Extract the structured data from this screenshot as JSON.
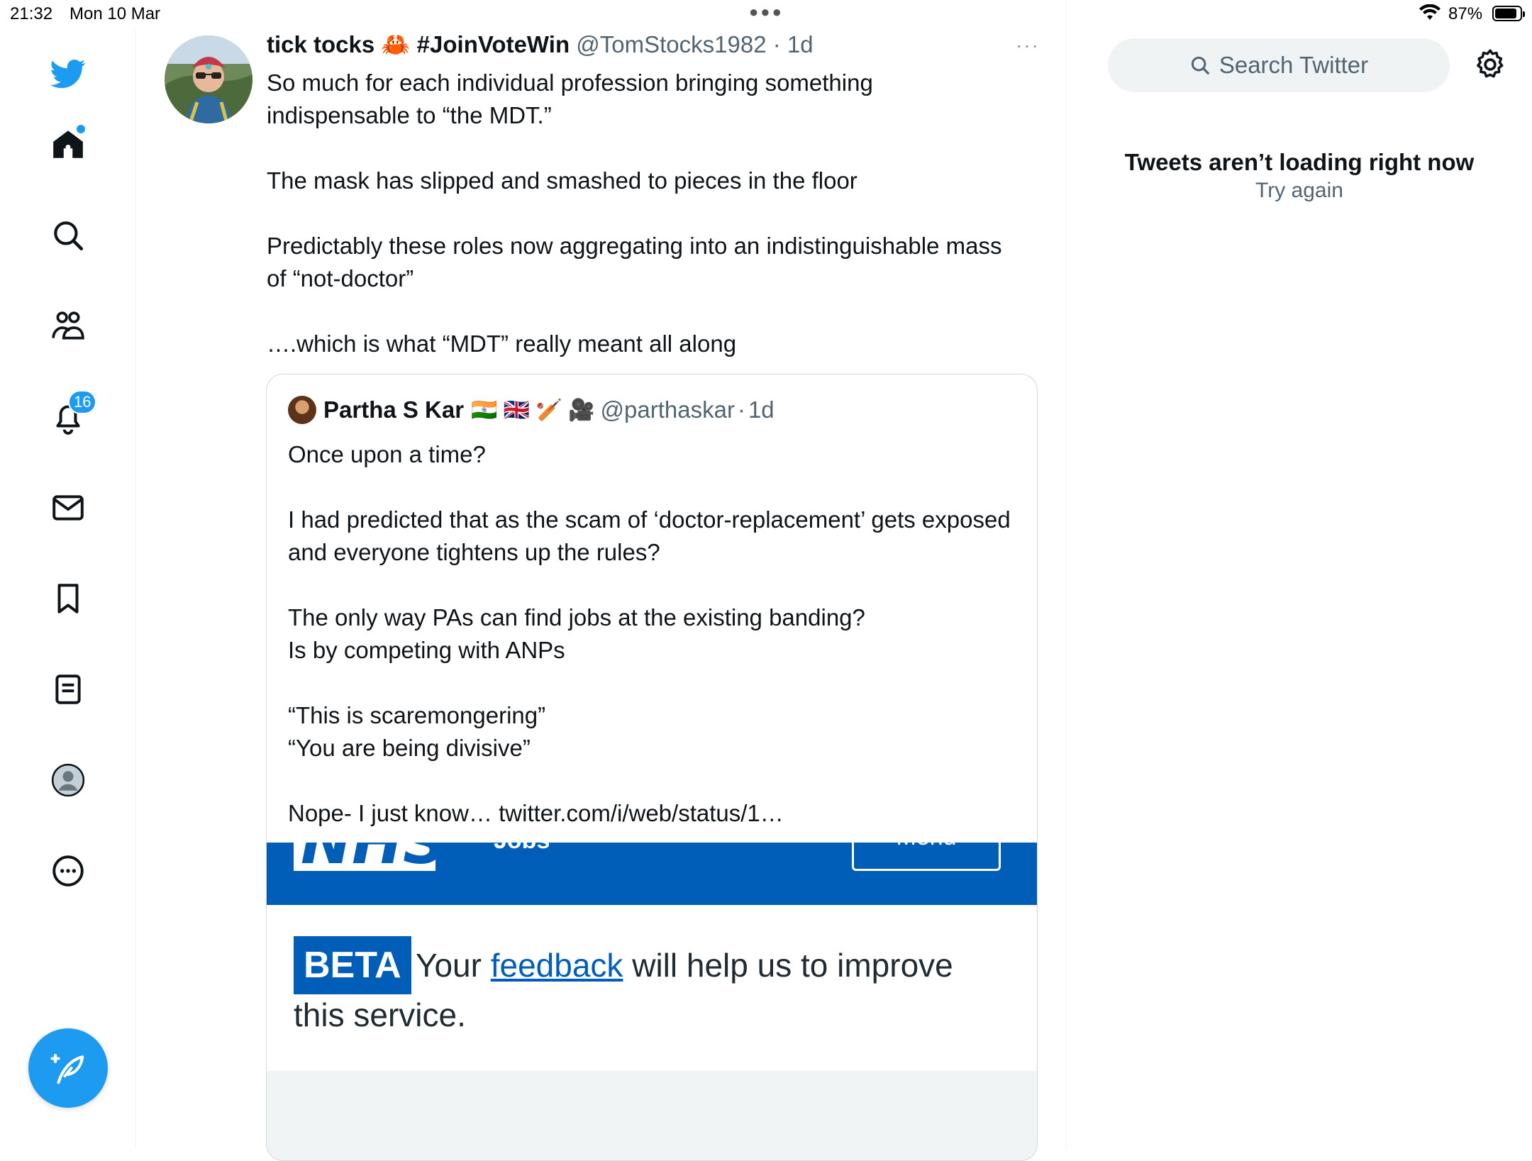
{
  "status_bar": {
    "time": "21:32",
    "date": "Mon 10 Mar",
    "battery_percent": "87%",
    "battery_level": 0.87,
    "wifi_icon": "wifi-icon"
  },
  "nav": {
    "items": [
      {
        "name": "twitter-logo-icon"
      },
      {
        "name": "home-icon"
      },
      {
        "name": "search-icon"
      },
      {
        "name": "communities-icon"
      },
      {
        "name": "notifications-icon",
        "badge": "16"
      },
      {
        "name": "messages-icon"
      },
      {
        "name": "bookmarks-icon"
      },
      {
        "name": "lists-icon"
      },
      {
        "name": "profile-icon"
      },
      {
        "name": "more-icon"
      }
    ],
    "compose_icon": "compose-tweet-icon",
    "accent_color": "#1d9bf0"
  },
  "tweet": {
    "name": "tick tocks 🦀 #JoinVoteWin",
    "handle": "@TomStocks1982",
    "separator": "·",
    "time": "1d",
    "more": "···",
    "paragraphs": [
      "So much for each individual profession bringing something indispensable to “the MDT.”",
      "The mask has slipped and smashed to pieces in the floor",
      "Predictably these roles now aggregating into an indistinguishable mass of “not-doctor”",
      "….which is what “MDT” really meant all along"
    ],
    "quote": {
      "name": "Partha S Kar",
      "emojis": "🇮🇳 🇬🇧 🏏 🎥",
      "handle": "@parthaskar",
      "separator": "·",
      "time": "1d",
      "paragraphs": [
        "Once upon a time?",
        "I had predicted that as the scam of ‘doctor-replacement’ gets exposed and everyone tightens up the rules?",
        "The only way PAs can find jobs at the existing banding?\nIs by competing with ANPs",
        "“This is scaremongering”\n“You are being divisive”",
        "Nope- I just know… twitter.com/i/web/status/1…"
      ],
      "media": {
        "logo_text": "NHS",
        "sub_text": "Jobs",
        "menu_text": "Menu",
        "beta_tag": "BETA",
        "beta_before": "Your ",
        "beta_link": "feedback",
        "beta_after": " will help us to improve this service.",
        "brand_color": "#005eb8"
      }
    }
  },
  "sidebar": {
    "search_placeholder": "Search Twitter",
    "settings_icon": "gear-icon",
    "error_title": "Tweets aren’t loading right now",
    "retry_label": "Try again"
  }
}
